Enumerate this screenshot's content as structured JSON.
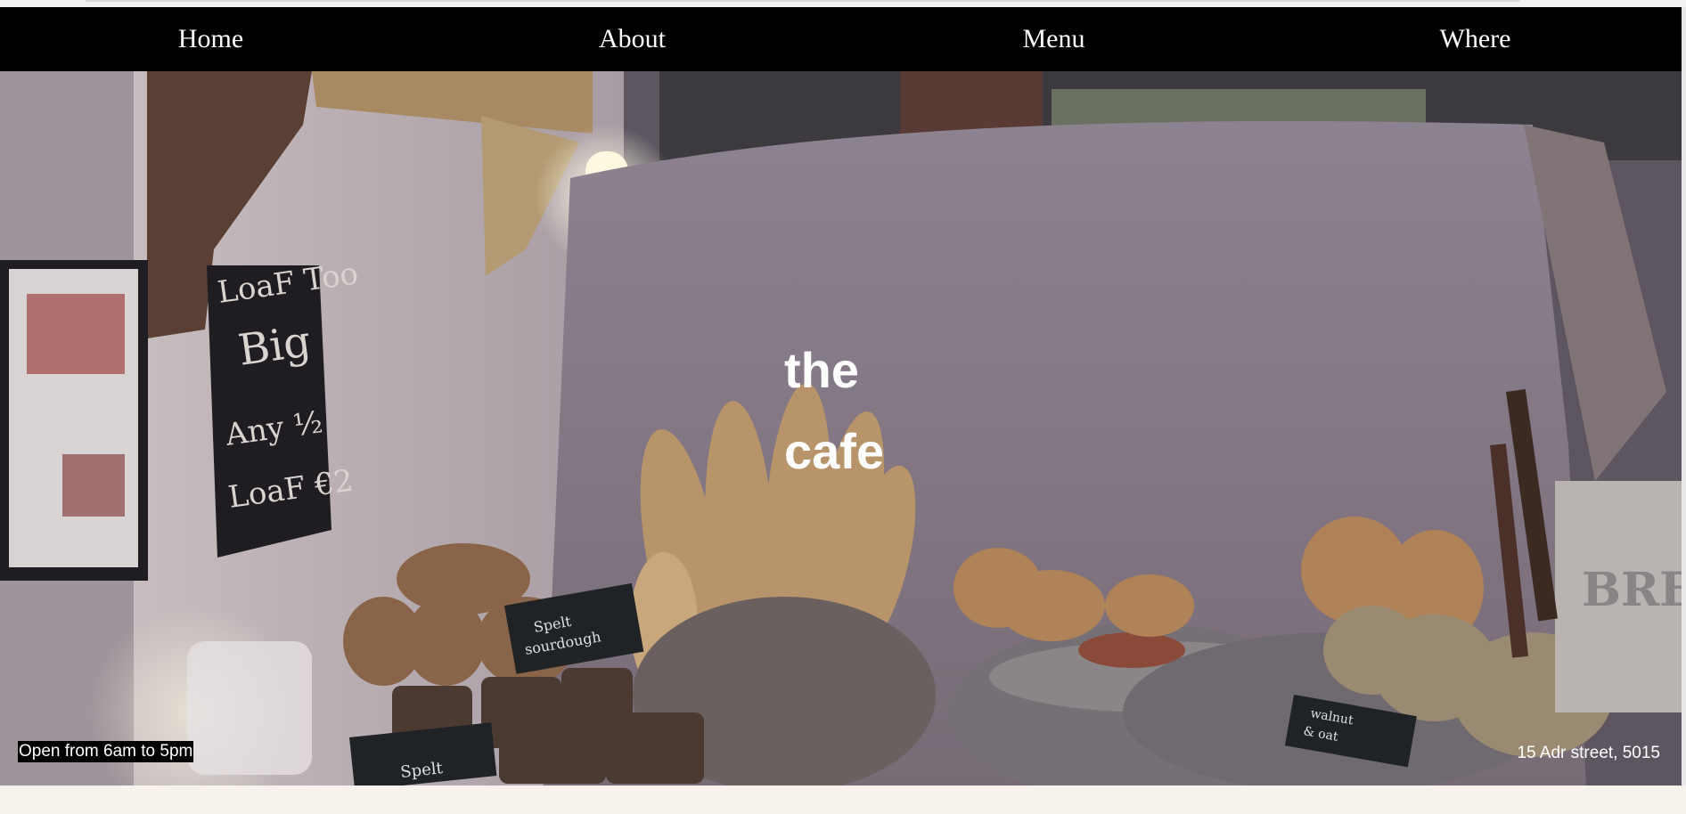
{
  "nav": {
    "items": [
      {
        "label": "Home"
      },
      {
        "label": "About"
      },
      {
        "label": "Menu"
      },
      {
        "label": "Where"
      }
    ]
  },
  "hero": {
    "title_line1": "the",
    "title_line2": "cafe",
    "hours": "Open from 6am to 5pm",
    "address": "15 Adr street, 5015",
    "chalkboard_text": [
      "LoaF Too",
      "Big",
      "Any ½",
      "LoaF €2"
    ],
    "signs": [
      "Spelt sourdough",
      "Spelt",
      "walnut & oat"
    ],
    "oven_letters": "BRE"
  },
  "colors": {
    "nav_bg": "#000000",
    "nav_text": "#ffffff",
    "page_bg": "#f7f2ec"
  }
}
